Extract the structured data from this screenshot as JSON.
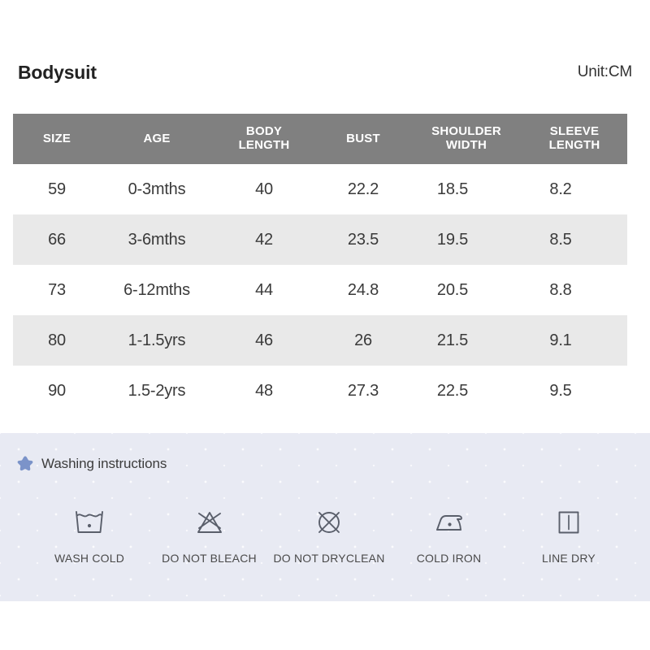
{
  "header": {
    "product_title": "Bodysuit",
    "unit_label": "Unit:CM"
  },
  "table": {
    "columns": [
      {
        "key": "size",
        "label": "SIZE"
      },
      {
        "key": "age",
        "label": "AGE"
      },
      {
        "key": "body",
        "label": "BODY\nLENGTH"
      },
      {
        "key": "bust",
        "label": "BUST"
      },
      {
        "key": "shoulder",
        "label": "SHOULDER\nWIDTH"
      },
      {
        "key": "sleeve",
        "label": "SLEEVE\nLENGTH"
      }
    ],
    "rows": [
      {
        "size": "59",
        "age": "0-3mths",
        "body": "40",
        "bust": "22.2",
        "shoulder": "18.5",
        "sleeve": "8.2"
      },
      {
        "size": "66",
        "age": "3-6mths",
        "body": "42",
        "bust": "23.5",
        "shoulder": "19.5",
        "sleeve": "8.5"
      },
      {
        "size": "73",
        "age": "6-12mths",
        "body": "44",
        "bust": "24.8",
        "shoulder": "20.5",
        "sleeve": "8.8"
      },
      {
        "size": "80",
        "age": "1-1.5yrs",
        "body": "46",
        "bust": "26",
        "shoulder": "21.5",
        "sleeve": "9.1"
      },
      {
        "size": "90",
        "age": "1.5-2yrs",
        "body": "48",
        "bust": "27.3",
        "shoulder": "22.5",
        "sleeve": "9.5"
      }
    ]
  },
  "washing": {
    "heading": "Washing instructions",
    "star_icon": "star-icon",
    "items": [
      {
        "icon": "wash-cold-icon",
        "label": "WASH COLD"
      },
      {
        "icon": "do-not-bleach-icon",
        "label": "DO NOT BLEACH"
      },
      {
        "icon": "do-not-dryclean-icon",
        "label": "DO NOT DRYCLEAN"
      },
      {
        "icon": "cold-iron-icon",
        "label": "COLD IRON"
      },
      {
        "icon": "line-dry-icon",
        "label": "LINE DRY"
      }
    ]
  },
  "colors": {
    "header_bar": "#808080",
    "row_alt": "#e9e9e9",
    "panel_bg": "#e8eaf3",
    "star_blue": "#7b93c9",
    "glyph_stroke": "#5a5f6b"
  }
}
